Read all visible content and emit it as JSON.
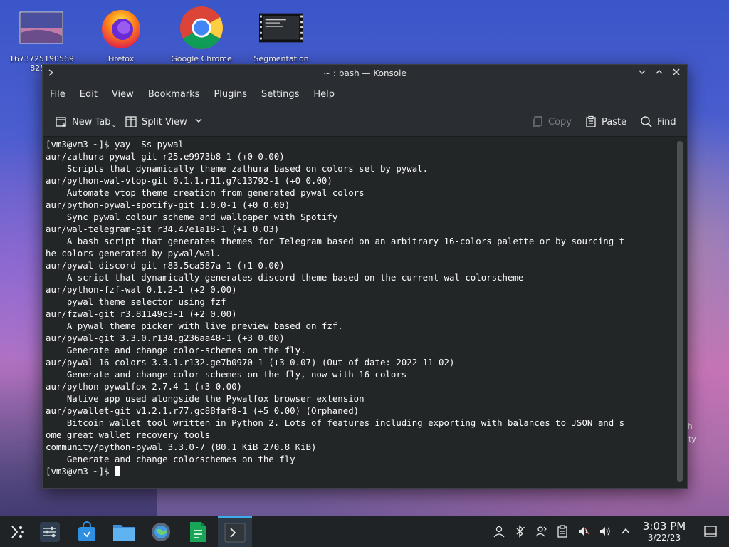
{
  "desktop": {
    "icons": [
      {
        "label": "1673725190569 825...",
        "icon": "image-file-icon"
      },
      {
        "label": "Firefox",
        "icon": "firefox-icon"
      },
      {
        "label": "Google Chrome",
        "icon": "chrome-icon"
      },
      {
        "label": "Segmentation",
        "icon": "video-file-icon"
      }
    ],
    "right_peek_label": "sh\npty"
  },
  "window": {
    "title": "~ : bash — Konsole",
    "controls": {
      "minimize": "⌄",
      "maximize": "⌃",
      "close": "✕"
    }
  },
  "menubar": {
    "items": [
      "File",
      "Edit",
      "View",
      "Bookmarks",
      "Plugins",
      "Settings",
      "Help"
    ]
  },
  "toolbar": {
    "new_tab": "New Tab",
    "split_view": "Split View",
    "copy": "Copy",
    "paste": "Paste",
    "find": "Find"
  },
  "terminal": {
    "lines": [
      "[vm3@vm3 ~]$ yay -Ss pywal",
      "aur/zathura-pywal-git r25.e9973b8-1 (+0 0.00)",
      "    Scripts that dynamically theme zathura based on colors set by pywal.",
      "aur/python-wal-vtop-git 0.1.1.r11.g7c13792-1 (+0 0.00)",
      "    Automate vtop theme creation from generated pywal colors",
      "aur/python-pywal-spotify-git 1.0.0-1 (+0 0.00)",
      "    Sync pywal colour scheme and wallpaper with Spotify",
      "aur/wal-telegram-git r34.47e1a18-1 (+1 0.03)",
      "    A bash script that generates themes for Telegram based on an arbitrary 16-colors palette or by sourcing t",
      "he colors generated by pywal/wal.",
      "aur/pywal-discord-git r83.5ca587a-1 (+1 0.00)",
      "    A script that dynamically generates discord theme based on the current wal colorscheme",
      "aur/python-fzf-wal 0.1.2-1 (+2 0.00)",
      "    pywal theme selector using fzf",
      "aur/fzwal-git r3.81149c3-1 (+2 0.00)",
      "    A pywal theme picker with live preview based on fzf.",
      "aur/pywal-git 3.3.0.r134.g236aa48-1 (+3 0.00)",
      "    Generate and change color-schemes on the fly.",
      "aur/pywal-16-colors 3.3.1.r132.ge7b0970-1 (+3 0.07) (Out-of-date: 2022-11-02)",
      "    Generate and change color-schemes on the fly, now with 16 colors",
      "aur/python-pywalfox 2.7.4-1 (+3 0.00)",
      "    Native app used alongside the Pywalfox browser extension",
      "aur/pywallet-git v1.2.1.r77.gc88faf8-1 (+5 0.00) (Orphaned)",
      "    Bitcoin wallet tool written in Python 2. Lots of features including exporting with balances to JSON and s",
      "ome great wallet recovery tools",
      "community/python-pywal 3.3.0-7 (80.1 KiB 270.8 KiB)",
      "    Generate and change colorschemes on the fly"
    ],
    "prompt": "[vm3@vm3 ~]$ "
  },
  "taskbar": {
    "apps": [
      {
        "name": "app-launcher",
        "icon": "kde-launcher-icon"
      },
      {
        "name": "system-settings",
        "icon": "sliders-icon"
      },
      {
        "name": "discover",
        "icon": "store-bag-icon"
      },
      {
        "name": "dolphin",
        "icon": "folder-icon"
      },
      {
        "name": "browser",
        "icon": "globe-gear-icon"
      },
      {
        "name": "libreoffice",
        "icon": "document-icon"
      },
      {
        "name": "konsole",
        "icon": "terminal-icon"
      }
    ],
    "tray": [
      "user-icon",
      "bluetooth-icon",
      "user-switch-icon",
      "clipboard-icon",
      "audio-muted-icon",
      "volume-icon",
      "chevron-up-icon"
    ],
    "clock": {
      "time": "3:03 PM",
      "date": "3/22/23"
    }
  },
  "colors": {
    "accent": "#3daee9",
    "terminal_bg": "#232627",
    "terminal_fg": "#fcfcfc",
    "titlebar_bg": "#2a2e32"
  }
}
